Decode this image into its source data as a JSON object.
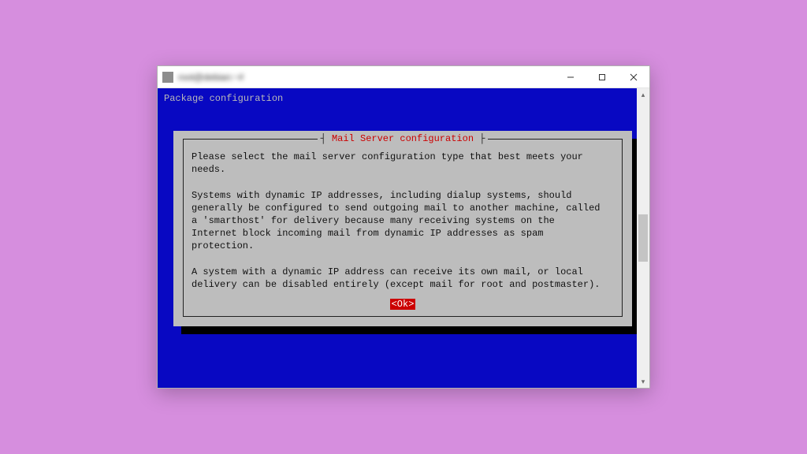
{
  "window": {
    "title": "root@debian:~#"
  },
  "terminal": {
    "header": "Package configuration"
  },
  "dialog": {
    "title": "Mail Server configuration",
    "body": "Please select the mail server configuration type that best meets your\nneeds.\n\nSystems with dynamic IP addresses, including dialup systems, should\ngenerally be configured to send outgoing mail to another machine, called\na 'smarthost' for delivery because many receiving systems on the\nInternet block incoming mail from dynamic IP addresses as spam\nprotection.\n\nA system with a dynamic IP address can receive its own mail, or local\ndelivery can be disabled entirely (except mail for root and postmaster).",
    "ok_label": "<Ok>"
  }
}
